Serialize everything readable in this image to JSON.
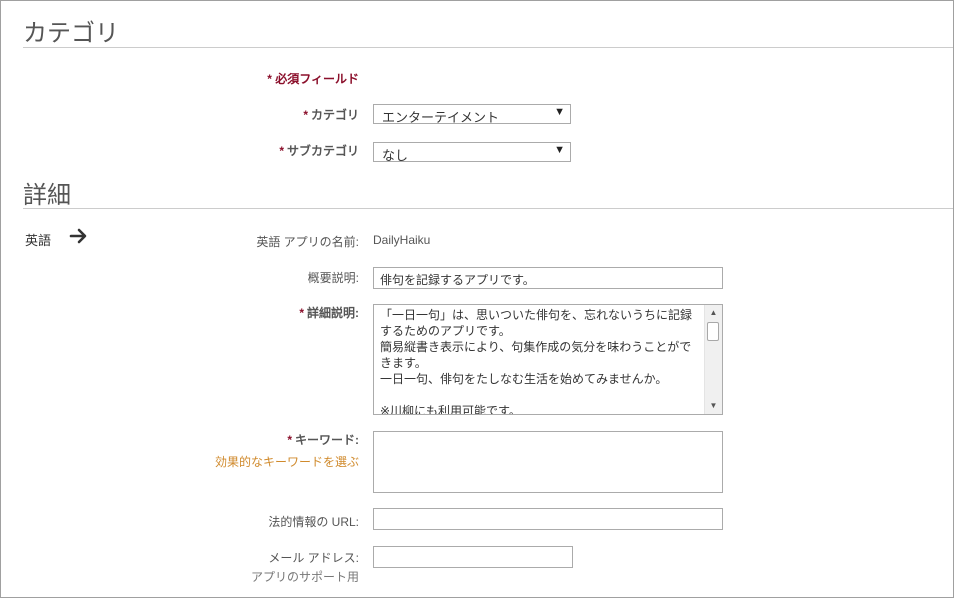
{
  "category_section": {
    "title": "カテゴリ",
    "required_note": "* 必須フィールド",
    "category": {
      "label": "カテゴリ",
      "value": "エンターテイメント"
    },
    "subcategory": {
      "label": "サブカテゴリ",
      "value": "なし"
    }
  },
  "details_section": {
    "title": "詳細",
    "language": "英語",
    "app_name": {
      "label": "英語 アプリの名前:",
      "value": "DailyHaiku"
    },
    "summary": {
      "label": "概要説明:",
      "value": "俳句を記録するアプリです。"
    },
    "description": {
      "label": "詳細説明:",
      "value": "「一日一句」は、思いついた俳句を、忘れないうちに記録するためのアプリです。\n簡易縦書き表示により、句集作成の気分を味わうことができます。\n一日一句、俳句をたしなむ生活を始めてみませんか。\n\n※川柳にも利用可能です。"
    },
    "keywords": {
      "label": "キーワード:",
      "link": "効果的なキーワードを選ぶ",
      "value": ""
    },
    "legal_url": {
      "label": "法的情報の URL:",
      "value": ""
    },
    "email": {
      "label": "メール アドレス:",
      "sublabel": "アプリのサポート用",
      "value": ""
    }
  },
  "icons": {
    "language_arrow": "arrow-right-icon",
    "dropdown": "chevron-down-icon"
  },
  "colors": {
    "required": "#8b0f2b",
    "link": "#d08a2c",
    "border": "#ababab"
  }
}
